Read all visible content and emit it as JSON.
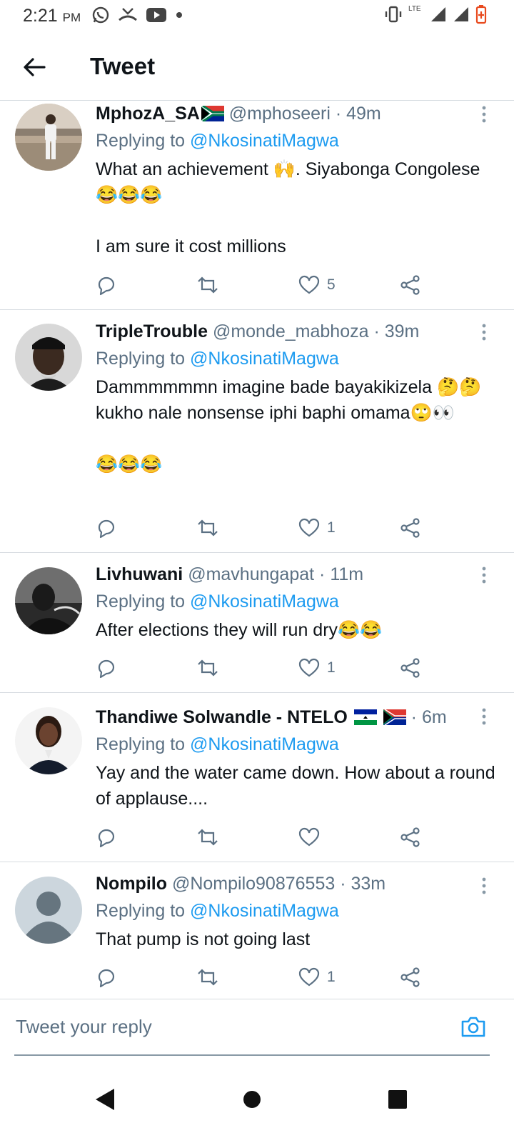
{
  "status_bar": {
    "time": "2:21",
    "ampm": "PM",
    "network": "LTE"
  },
  "app_bar": {
    "title": "Tweet"
  },
  "tweets": [
    {
      "name": "MphozA_SA",
      "handle": "@mphoseeri",
      "time": "49m",
      "replying_prefix": "Replying to",
      "reply_to": "@NkosinatiMagwa",
      "text": "What an achievement 🙌. Siyabonga Congolese 😂😂😂\n\nI am sure it cost millions",
      "likes": "5"
    },
    {
      "name": "TripleTrouble",
      "handle": "@monde_mabhoza",
      "time": "39m",
      "replying_prefix": "Replying to",
      "reply_to": "@NkosinatiMagwa",
      "text": "Dammmmmmn imagine bade bayakikizela 🤔🤔 kukho nale nonsense iphi baphi omama🙄👀\n\n😂😂😂",
      "likes": "1"
    },
    {
      "name": "Livhuwani",
      "handle": "@mavhungapat",
      "time": "11m",
      "replying_prefix": "Replying to",
      "reply_to": "@NkosinatiMagwa",
      "text": "After elections they will run dry😂😂",
      "likes": "1"
    },
    {
      "name": "Thandiwe Solwandle - NTELO",
      "handle": "",
      "time": "6m",
      "replying_prefix": "Replying to",
      "reply_to": "@NkosinatiMagwa",
      "text": "Yay and the water came down. How about a round of applause....",
      "likes": ""
    },
    {
      "name": "Nompilo",
      "handle": "@Nompilo90876553",
      "time": "33m",
      "replying_prefix": "Replying to",
      "reply_to": "@NkosinatiMagwa",
      "text": "That pump is not going last",
      "likes": "1"
    }
  ],
  "composer": {
    "placeholder": "Tweet your reply"
  },
  "colors": {
    "accent": "#1d9bf0",
    "secondary_text": "#5b7083",
    "divider": "#d6dbe0"
  }
}
